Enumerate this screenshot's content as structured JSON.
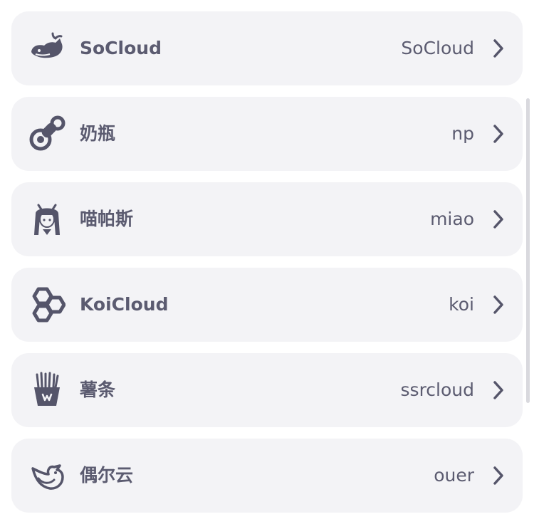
{
  "colors": {
    "row_bg": "#f3f3f6",
    "text": "#5b5b70",
    "icon": "#55556a"
  },
  "rows": [
    {
      "icon": "whale-icon",
      "label": "SoCloud",
      "value": "SoCloud"
    },
    {
      "icon": "pacifier-icon",
      "label": "奶瓶",
      "value": "np"
    },
    {
      "icon": "anime-girl-icon",
      "label": "喵帕斯",
      "value": "miao"
    },
    {
      "icon": "hexagons-icon",
      "label": "KoiCloud",
      "value": "koi"
    },
    {
      "icon": "fries-icon",
      "label": "薯条",
      "value": "ssrcloud"
    },
    {
      "icon": "bird-icon",
      "label": "偶尔云",
      "value": "ouer"
    }
  ],
  "chevron_icon": "chevron-right-icon"
}
